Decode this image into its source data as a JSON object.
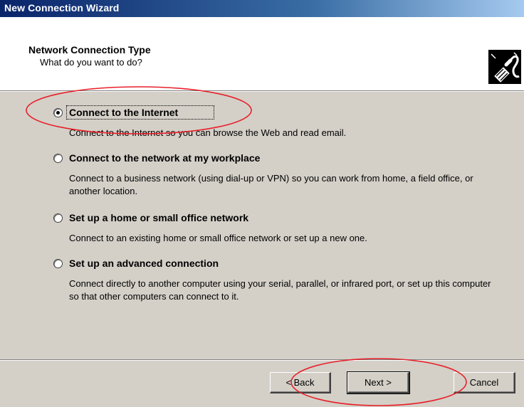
{
  "window": {
    "title": "New Connection Wizard"
  },
  "header": {
    "title": "Network Connection Type",
    "subtitle": "What do you want to do?",
    "icon": "network-cable-icon"
  },
  "options": [
    {
      "label": "Connect to the Internet",
      "description": "Connect to the Internet so you can browse the Web and read email.",
      "selected": true
    },
    {
      "label": "Connect to the network at my workplace",
      "description": "Connect to a business network (using dial-up or VPN) so you can work from home, a field office, or another location.",
      "selected": false
    },
    {
      "label": "Set up a home or small office network",
      "description": "Connect to an existing home or small office network or set up a new one.",
      "selected": false
    },
    {
      "label": "Set up an advanced connection",
      "description": "Connect directly to another computer using your serial, parallel, or infrared port, or set up this computer so that other computers can connect to it.",
      "selected": false
    }
  ],
  "buttons": {
    "back": "< Back",
    "next": "Next >",
    "cancel": "Cancel"
  },
  "annotations": {
    "color": "#e8202a"
  }
}
